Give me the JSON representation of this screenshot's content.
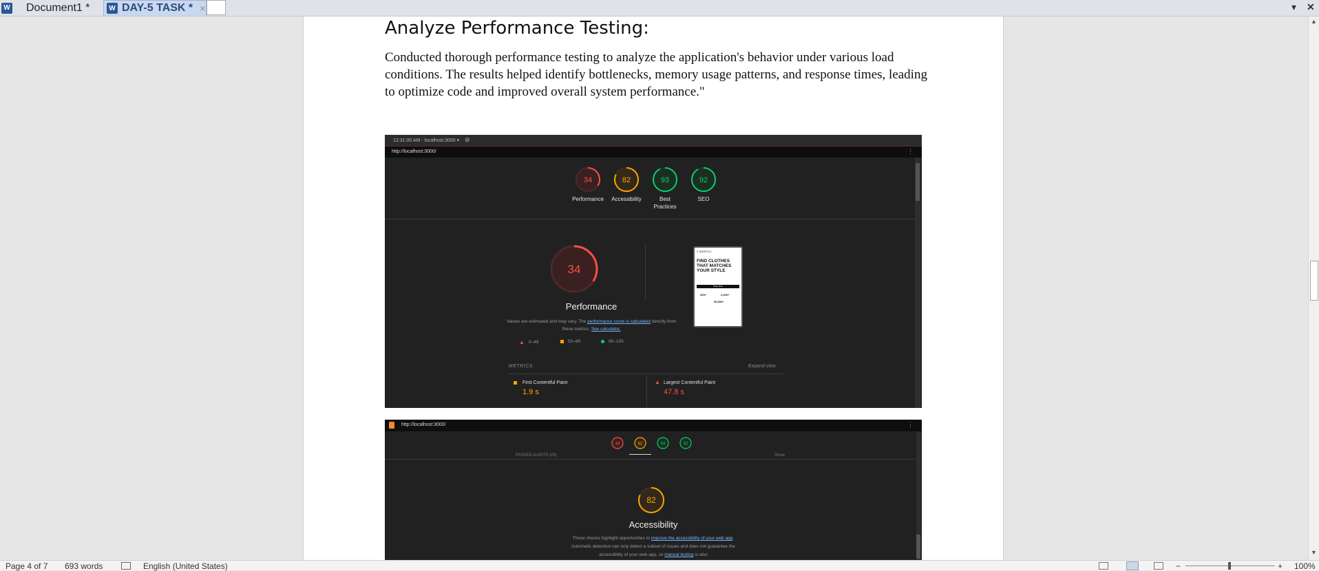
{
  "tabs": [
    {
      "label": "Document1 *"
    },
    {
      "label": "DAY-5 TASK *",
      "close": "×"
    }
  ],
  "window_controls": {
    "dropdown": "▾",
    "close": "✕"
  },
  "document": {
    "heading": "Analyze Performance Testing:",
    "paragraph": "Conducted thorough performance testing to analyze the application's behavior under various load conditions. The results helped identify bottlenecks, memory usage patterns, and response times, leading to optimize code and improved overall system performance.\""
  },
  "shot1": {
    "devbar_time": "12:31:00 AM - localhost:3000 ▾",
    "url": "http://localhost:3000/",
    "scores": [
      {
        "value": "34",
        "label": "Performance",
        "color": "#ff4e42"
      },
      {
        "value": "82",
        "label": "Accessibility",
        "color": "#ffa400"
      },
      {
        "value": "93",
        "label": "Best Practices",
        "color": "#0cce6b"
      },
      {
        "value": "92",
        "label": "SEO",
        "color": "#0cce6b"
      }
    ],
    "big_score": "34",
    "perf_title": "Performance",
    "desc_1": "Values are estimated and may vary. The ",
    "desc_link1": "performance score is calculated",
    "desc_2": " directly from these metrics. ",
    "desc_link2": "See calculator.",
    "legend": [
      "0–49",
      "50–89",
      "90–100"
    ],
    "metrics_header": "METRICS",
    "expand": "Expand view",
    "metrics": [
      {
        "name": "First Contentful Paint",
        "value": "1.9 s",
        "color": "#ffa400"
      },
      {
        "name": "Largest Contentful Paint",
        "value": "47.8 s",
        "color": "#ff4e42"
      }
    ],
    "phone": {
      "brand": "≡ SHOP.CO",
      "headline": "FIND CLOTHES THAT MATCHES YOUR STYLE",
      "button": "Shop Now",
      "stat1": "200+",
      "stat2": "2,000+",
      "stat3": "30,000+"
    }
  },
  "shot2": {
    "url": "http://localhost:3000/",
    "mini_scores": [
      "34",
      "82",
      "93",
      "92"
    ],
    "passed": "PASSED AUDITS (23)",
    "show": "Show",
    "score": "82",
    "title": "Accessibility",
    "desc_1": "These checks highlight opportunities to ",
    "desc_link1": "improve the accessibility of your web app",
    "desc_2": ". Automatic detection can only detect a subset of issues and does not guarantee the accessibility of your web app, so ",
    "desc_link2": "manual testing",
    "desc_3": " is also"
  },
  "status_bar": {
    "page": "Page 4 of 7",
    "words": "693 words",
    "language": "English (United States)",
    "zoom": "100%",
    "zoom_minus": "−",
    "zoom_plus": "+"
  }
}
